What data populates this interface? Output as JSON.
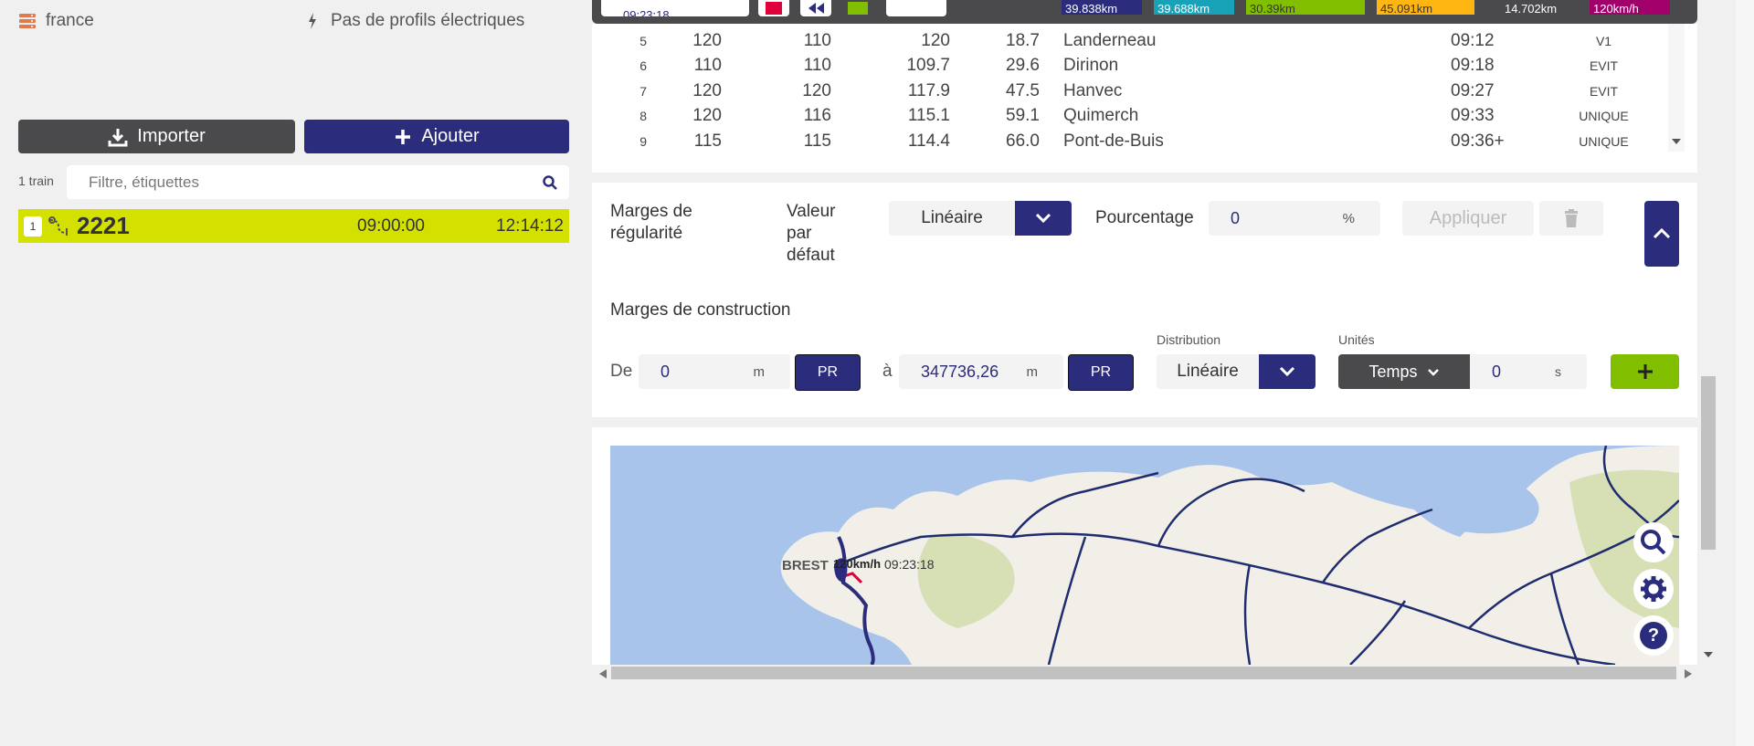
{
  "left": {
    "infra_label": "france",
    "electric_label": "Pas de profils électriques",
    "import_label": "Importer",
    "add_label": "Ajouter",
    "train_count": "1 train",
    "filter_placeholder": "Filtre, étiquettes",
    "train": {
      "index": "1",
      "name": "2221",
      "start": "09:00:00",
      "end": "12:14:12"
    }
  },
  "toolbar": {
    "time": "09:23:18",
    "badges": [
      {
        "text": "39.838km",
        "color": "#2b2c7c"
      },
      {
        "text": "39.688km",
        "color": "#17a2b8"
      },
      {
        "text": "30.39km",
        "color": "#82be00"
      },
      {
        "text": "45.091km",
        "color": "#ffb612"
      },
      {
        "text": "14.702km",
        "color": "#4a4a4c"
      },
      {
        "text": "120km/h",
        "color": "#a1006b"
      }
    ]
  },
  "steps": {
    "rows": [
      {
        "n": "5",
        "a": "120",
        "b": "110",
        "c": "120",
        "d": "18.7",
        "name": "Landerneau",
        "time": "09:12",
        "type": "V1"
      },
      {
        "n": "6",
        "a": "110",
        "b": "110",
        "c": "109.7",
        "d": "29.6",
        "name": "Dirinon",
        "time": "09:18",
        "type": "EVIT"
      },
      {
        "n": "7",
        "a": "120",
        "b": "120",
        "c": "117.9",
        "d": "47.5",
        "name": "Hanvec",
        "time": "09:27",
        "type": "EVIT"
      },
      {
        "n": "8",
        "a": "120",
        "b": "116",
        "c": "115.1",
        "d": "59.1",
        "name": "Quimerch",
        "time": "09:33",
        "type": "UNIQUE"
      },
      {
        "n": "9",
        "a": "115",
        "b": "115",
        "c": "114.4",
        "d": "66.0",
        "name": "Pont-de-Buis",
        "time": "09:36+",
        "type": "UNIQUE"
      }
    ]
  },
  "margins": {
    "regularity_title": "Marges de régularité",
    "default_value_label": "Valeur par défaut",
    "mode": "Linéaire",
    "percent_label": "Pourcentage",
    "percent_value": "0",
    "percent_unit": "%",
    "apply_label": "Appliquer",
    "construction_title": "Marges de construction",
    "from_label": "De",
    "from_value": "0",
    "from_unit": "m",
    "pr_label": "PR",
    "to_label": "à",
    "to_value": "347736,26",
    "to_unit": "m",
    "distribution_label": "Distribution",
    "distribution_value": "Linéaire",
    "units_label": "Unités",
    "units_value": "Temps",
    "units_amount": "0",
    "units_suffix": "s"
  },
  "map": {
    "city": "BREST",
    "speed": "120km/h",
    "time": "09:23:18"
  }
}
